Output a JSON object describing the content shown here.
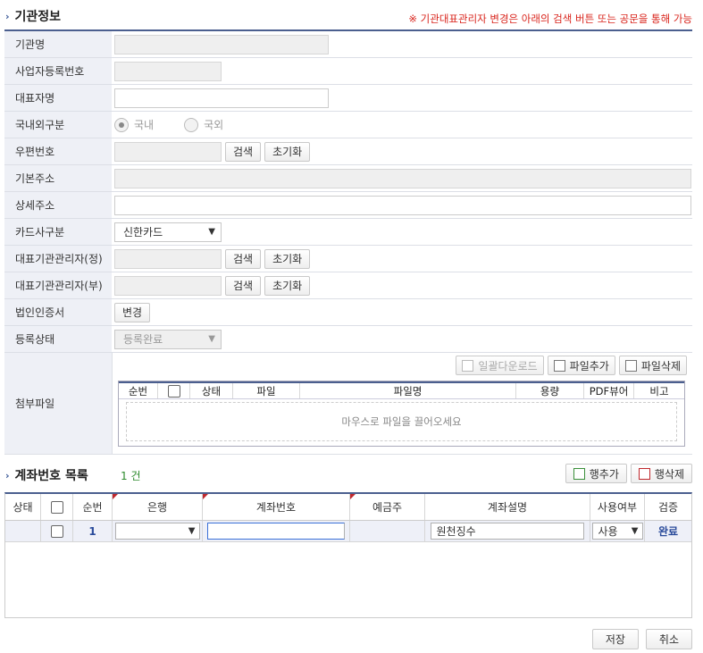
{
  "section1": {
    "title": "기관정보",
    "notice": "※ 기관대표관리자 변경은 아래의 검색 버튼 또는 공문을 통해 가능"
  },
  "form": {
    "org_name_label": "기관명",
    "bizno_label": "사업자등록번호",
    "rep_name_label": "대표자명",
    "domestic_label": "국내외구분",
    "radio_domestic": "국내",
    "radio_foreign": "국외",
    "zipcode_label": "우편번호",
    "search_btn": "검색",
    "reset_btn": "초기화",
    "addr_label": "기본주소",
    "addr_detail_label": "상세주소",
    "card_label": "카드사구분",
    "card_value": "신한카드",
    "mgr_main_label": "대표기관관리자(정)",
    "mgr_sub_label": "대표기관관리자(부)",
    "cert_label": "법인인증서",
    "change_btn": "변경",
    "status_label": "등록상태",
    "status_value": "등록완료",
    "attach_label": "첨부파일"
  },
  "files": {
    "download_all": "일괄다운로드",
    "add_file": "파일추가",
    "delete_file": "파일삭제",
    "headers": [
      "순번",
      "상태",
      "파일",
      "파일명",
      "용량",
      "PDF뷰어",
      "비고"
    ],
    "empty_text": "마우스로 파일을 끌어오세요"
  },
  "accounts": {
    "title": "계좌번호 목록",
    "count": "1 건",
    "add_row": "행추가",
    "delete_row": "행삭제",
    "headers": [
      "상태",
      "순번",
      "은행",
      "계좌번호",
      "예금주",
      "계좌설명",
      "사용여부",
      "검증"
    ],
    "row": {
      "seq": "1",
      "bank": "",
      "account_no": "",
      "holder": "",
      "description": "원천징수",
      "use": "사용",
      "verify": "완료"
    }
  },
  "footer": {
    "save": "저장",
    "cancel": "취소"
  }
}
